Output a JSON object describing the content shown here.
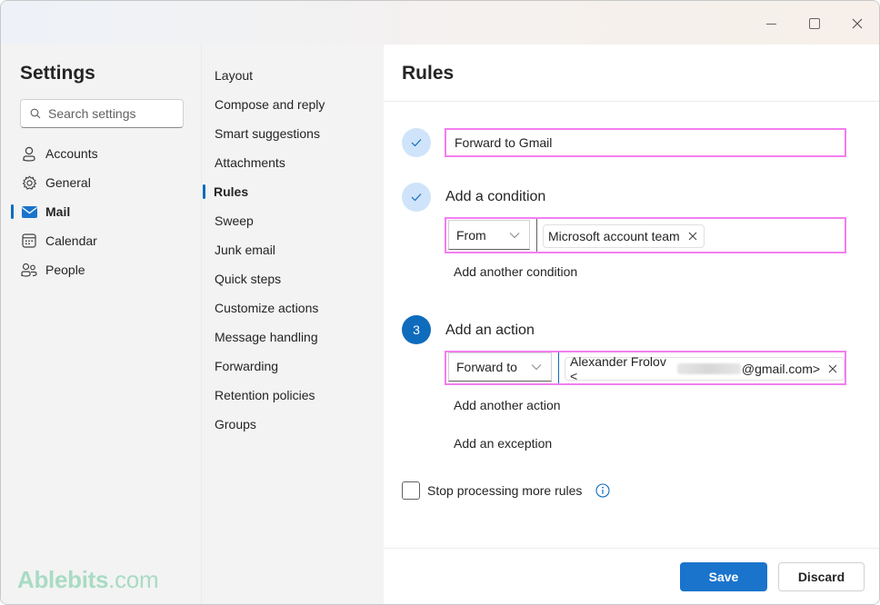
{
  "window": {
    "controls": {
      "minimize": "minimize",
      "maximize": "maximize",
      "close": "close"
    }
  },
  "sidebar": {
    "title": "Settings",
    "search": {
      "placeholder": "Search settings",
      "value": ""
    },
    "items": [
      {
        "label": "Accounts",
        "icon": "person-icon",
        "active": false
      },
      {
        "label": "General",
        "icon": "gear-icon",
        "active": false
      },
      {
        "label": "Mail",
        "icon": "mail-icon",
        "active": true
      },
      {
        "label": "Calendar",
        "icon": "calendar-icon",
        "active": false
      },
      {
        "label": "People",
        "icon": "people-icon",
        "active": false
      }
    ]
  },
  "subnav": {
    "items": [
      {
        "label": "Layout",
        "active": false
      },
      {
        "label": "Compose and reply",
        "active": false
      },
      {
        "label": "Smart suggestions",
        "active": false
      },
      {
        "label": "Attachments",
        "active": false
      },
      {
        "label": "Rules",
        "active": true
      },
      {
        "label": "Sweep",
        "active": false
      },
      {
        "label": "Junk email",
        "active": false
      },
      {
        "label": "Quick steps",
        "active": false
      },
      {
        "label": "Customize actions",
        "active": false
      },
      {
        "label": "Message handling",
        "active": false
      },
      {
        "label": "Forwarding",
        "active": false
      },
      {
        "label": "Retention policies",
        "active": false
      },
      {
        "label": "Groups",
        "active": false
      }
    ]
  },
  "main": {
    "title": "Rules",
    "rule_name": {
      "value": "Forward to Gmail",
      "step_state": "done"
    },
    "condition": {
      "heading": "Add a condition",
      "step_state": "done",
      "type": "From",
      "chip": "Microsoft account team",
      "add_link": "Add another condition"
    },
    "action": {
      "heading": "Add an action",
      "step_number": "3",
      "type": "Forward to",
      "chip_prefix": "Alexander Frolov <",
      "chip_suffix": "@gmail.com>",
      "add_link": "Add another action",
      "exception_link": "Add an exception"
    },
    "stop_processing": {
      "label": "Stop processing more rules",
      "checked": false
    },
    "buttons": {
      "save": "Save",
      "discard": "Discard"
    }
  },
  "brand": {
    "name": "Ablebits",
    "suffix": ".com"
  },
  "colors": {
    "accent": "#0f6cbd",
    "save_button": "#1a74cc",
    "highlight": "#f27ff0",
    "step_done": "#cfe4fa"
  }
}
